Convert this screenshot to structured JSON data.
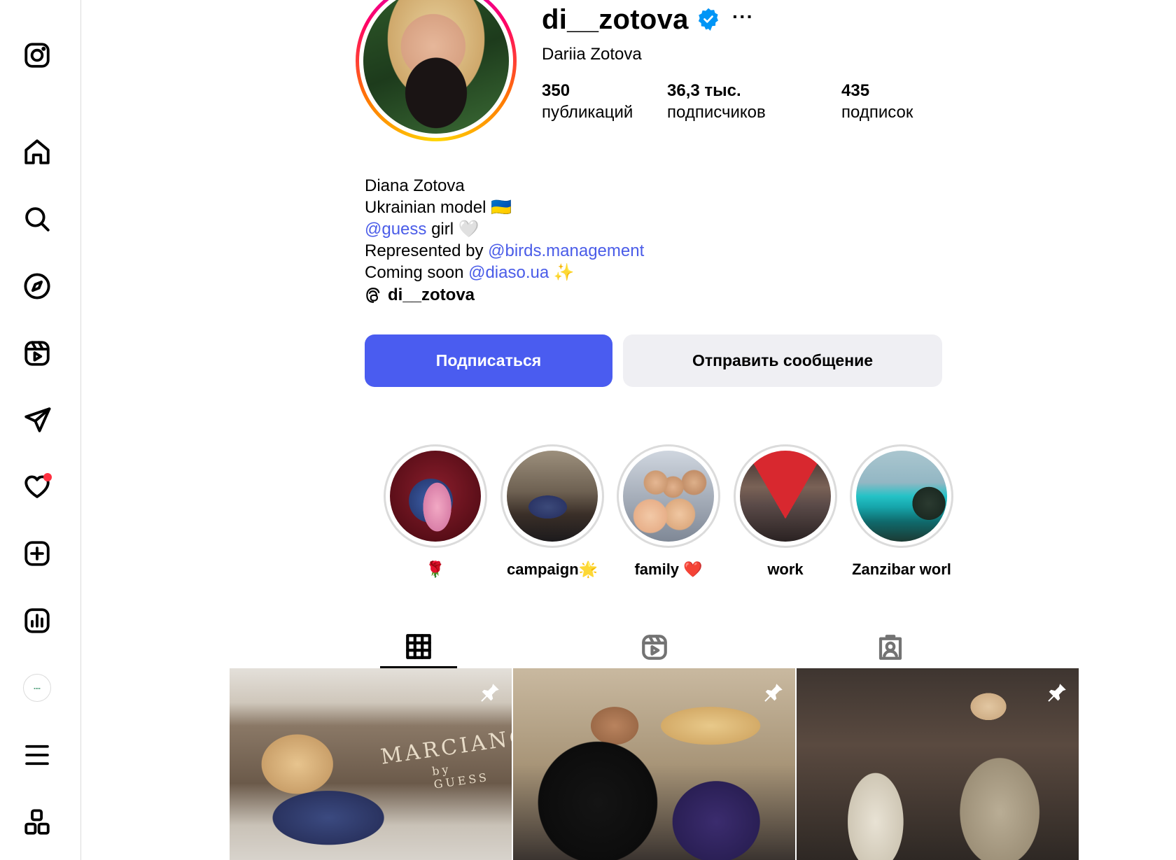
{
  "profile": {
    "username": "di__zotova",
    "full_name": "Dariia Zotova",
    "more": "···",
    "stats": [
      {
        "count": "350",
        "label": "публикаций"
      },
      {
        "count": "36,3 тыс.",
        "label": "подписчиков"
      },
      {
        "count": "435",
        "label": "подписок"
      }
    ]
  },
  "bio": {
    "line1": "Diana Zotova",
    "line2": "Ukrainian model 🇺🇦",
    "line3_link": "@guess",
    "line3_text": " girl 🤍",
    "line4_text": "Represented by ",
    "line4_link": "@birds.management",
    "line5_text": "Coming soon ",
    "line5_link": "@diaso.ua",
    "line5_emoji": " ✨",
    "threads_handle": "di__zotova"
  },
  "actions": {
    "follow": "Подписаться",
    "message": "Отправить сообщение"
  },
  "highlights": [
    {
      "label": "🌹"
    },
    {
      "label": "campaign🌟"
    },
    {
      "label": "family ❤️"
    },
    {
      "label": "work"
    },
    {
      "label": "Zanzibar worl"
    }
  ],
  "posts": [
    {
      "overlay_text": "MARCIANO",
      "overlay_sub": "by GUESS"
    },
    {
      "overlay_text": "",
      "overlay_sub": ""
    },
    {
      "overlay_text": "",
      "overlay_sub": ""
    }
  ],
  "colors": {
    "follow_button": "#4a5cf0",
    "link": "#4a5ce8",
    "notification_dot": "#ff3040",
    "verified_badge": "#0095f6"
  }
}
